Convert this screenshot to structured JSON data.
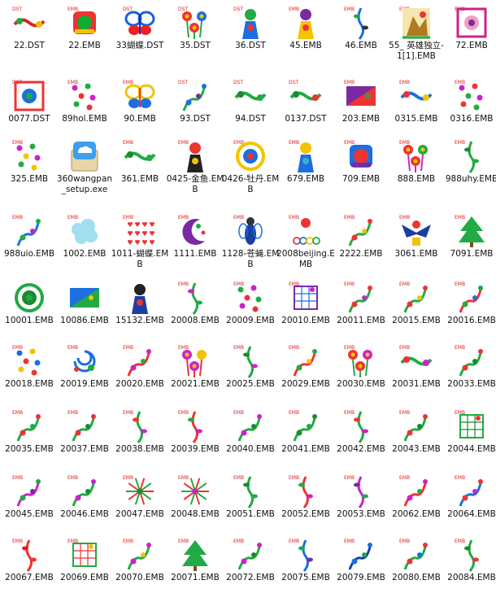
{
  "files": [
    {
      "name": "22.DST",
      "tag": "DST",
      "colors": [
        "#d22",
        "#2a4",
        "#e6c000"
      ],
      "motif": "wide"
    },
    {
      "name": "22.EMB",
      "tag": "EMB",
      "colors": [
        "#1a3",
        "#e33",
        "#f2c400"
      ],
      "motif": "badge"
    },
    {
      "name": "33蝴蝶.DST",
      "tag": "DST",
      "colors": [
        "#1c5fe0",
        "#e22",
        "#22b"
      ],
      "motif": "butterfly"
    },
    {
      "name": "35.DST",
      "tag": "DST",
      "colors": [
        "#e33",
        "#2a4",
        "#1b6fe0"
      ],
      "motif": "flowers"
    },
    {
      "name": "36.DST",
      "tag": "DST",
      "colors": [
        "#2a4",
        "#1b6fe0",
        "#e33"
      ],
      "motif": "figure"
    },
    {
      "name": "45.EMB",
      "tag": "EMB",
      "colors": [
        "#7a2aa0",
        "#f2c400",
        "#e33"
      ],
      "motif": "figure"
    },
    {
      "name": "46.EMB",
      "tag": "EMB",
      "colors": [
        "#1b6fe0",
        "#2a4",
        "#333"
      ],
      "motif": "stem"
    },
    {
      "name": "55_ 英雄独立-1[1].EMB",
      "tag": "EMB",
      "colors": [
        "#2a4",
        "#b07a20",
        "#e33"
      ],
      "motif": "scene"
    },
    {
      "name": "72.EMB",
      "tag": "EMB",
      "colors": [
        "#c28",
        "#f0a0c0",
        "#7a2aa0"
      ],
      "motif": "frame"
    },
    {
      "name": "0077.DST",
      "tag": "DST",
      "colors": [
        "#e33",
        "#1b6fe0",
        "#2a4"
      ],
      "motif": "frame"
    },
    {
      "name": "89hol.EMB",
      "tag": "EMB",
      "colors": [
        "#c2c",
        "#2a4",
        "#e33"
      ],
      "motif": "dots"
    },
    {
      "name": "90.EMB",
      "tag": "EMB",
      "colors": [
        "#f2c400",
        "#1b6fe0",
        "#e33"
      ],
      "motif": "butterfly"
    },
    {
      "name": "93.DST",
      "tag": "DST",
      "colors": [
        "#2a4",
        "#1b6fe0",
        "#7a2aa0"
      ],
      "motif": "vine"
    },
    {
      "name": "94.DST",
      "tag": "DST",
      "colors": [
        "#2a4",
        "#1a8a30",
        "#2a4"
      ],
      "motif": "wide"
    },
    {
      "name": "0137.DST",
      "tag": "DST",
      "colors": [
        "#2a4",
        "#1a8a30",
        "#e33"
      ],
      "motif": "wide"
    },
    {
      "name": "203.EMB",
      "tag": "EMB",
      "colors": [
        "#7a2aa0",
        "#e33",
        "#2a4"
      ],
      "motif": "flag"
    },
    {
      "name": "0315.EMB",
      "tag": "EMB",
      "colors": [
        "#1b6fe0",
        "#e33",
        "#f2c400"
      ],
      "motif": "wide"
    },
    {
      "name": "0316.EMB",
      "tag": "EMB",
      "colors": [
        "#c2c",
        "#e33",
        "#2a4"
      ],
      "motif": "dots"
    },
    {
      "name": "325.EMB",
      "tag": "EMB",
      "colors": [
        "#c2c",
        "#2a4",
        "#f2c400"
      ],
      "motif": "dots"
    },
    {
      "name": "360wangpan_setup.exe",
      "tag": "",
      "colors": [
        "#3aa0f0",
        "#1b6fe0",
        "#ffffff"
      ],
      "motif": "exe"
    },
    {
      "name": "361.EMB",
      "tag": "EMB",
      "colors": [
        "#2a4",
        "#1a8a30",
        "#2a4"
      ],
      "motif": "wide"
    },
    {
      "name": "0425-金鱼.EMB",
      "tag": "EMB",
      "colors": [
        "#e33",
        "#222",
        "#f2c400"
      ],
      "motif": "figure"
    },
    {
      "name": "0426-牡丹.EMB",
      "tag": "EMB",
      "colors": [
        "#f2c400",
        "#1b6fe0",
        "#e33"
      ],
      "motif": "round"
    },
    {
      "name": "679.EMB",
      "tag": "EMB",
      "colors": [
        "#f2c400",
        "#1b6fe0",
        "#3ab0d0"
      ],
      "motif": "figure"
    },
    {
      "name": "709.EMB",
      "tag": "EMB",
      "colors": [
        "#e33",
        "#1b6fe0",
        "#7a2aa0"
      ],
      "motif": "badge"
    },
    {
      "name": "888.EMB",
      "tag": "EMB",
      "colors": [
        "#e33",
        "#c2c",
        "#2a4"
      ],
      "motif": "flowers"
    },
    {
      "name": "988uhy.EMB",
      "tag": "EMB",
      "colors": [
        "#2a4",
        "#1a8a30",
        "#2a4"
      ],
      "motif": "stem"
    },
    {
      "name": "988uio.EMB",
      "tag": "EMB",
      "colors": [
        "#1b6fe0",
        "#2a4",
        "#c2c"
      ],
      "motif": "vine"
    },
    {
      "name": "1002.EMB",
      "tag": "EMB",
      "colors": [
        "#a0dff0",
        "#c0eefa",
        "#a0dff0"
      ],
      "motif": "cloud"
    },
    {
      "name": "1011-蝴蝶.EMB",
      "tag": "EMB",
      "colors": [
        "#e33",
        "#d22",
        "#e33"
      ],
      "motif": "hearts"
    },
    {
      "name": "1111.EMB",
      "tag": "EMB",
      "colors": [
        "#7a2aa0",
        "#2a4",
        "#e33"
      ],
      "motif": "moon"
    },
    {
      "name": "1128-苍蝇.EMB",
      "tag": "EMB",
      "colors": [
        "#1b3fa0",
        "#333",
        "#1b6fe0"
      ],
      "motif": "insect"
    },
    {
      "name": "2008beijing.EMB",
      "tag": "EMB",
      "colors": [
        "#e33",
        "#1b6fe0",
        "#f2c400"
      ],
      "motif": "rings"
    },
    {
      "name": "2222.EMB",
      "tag": "EMB",
      "colors": [
        "#2a4",
        "#e33",
        "#f2c400"
      ],
      "motif": "vine"
    },
    {
      "name": "3061.EMB",
      "tag": "EMB",
      "colors": [
        "#1b3fa0",
        "#e33",
        "#f2c400"
      ],
      "motif": "eagle"
    },
    {
      "name": "7091.EMB",
      "tag": "EMB",
      "colors": [
        "#2a4",
        "#1a8a30",
        "#2a4"
      ],
      "motif": "tree"
    },
    {
      "name": "10001.EMB",
      "tag": "",
      "colors": [
        "#2a4",
        "#1a8a30",
        "#2a4"
      ],
      "motif": "round"
    },
    {
      "name": "10086.EMB",
      "tag": "",
      "colors": [
        "#1b6fe0",
        "#2a4",
        "#f2c400"
      ],
      "motif": "flag"
    },
    {
      "name": "15132.EMB",
      "tag": "",
      "colors": [
        "#222",
        "#1b3fa0",
        "#e33"
      ],
      "motif": "figure"
    },
    {
      "name": "20008.EMB",
      "tag": "EMB",
      "colors": [
        "#2a4",
        "#c2c",
        "#2a4"
      ],
      "motif": "stem"
    },
    {
      "name": "20009.EMB",
      "tag": "EMB",
      "colors": [
        "#2a4",
        "#c2c",
        "#e33"
      ],
      "motif": "dots"
    },
    {
      "name": "20010.EMB",
      "tag": "EMB",
      "colors": [
        "#7a2aa0",
        "#1b6fe0",
        "#c2c"
      ],
      "motif": "net"
    },
    {
      "name": "20011.EMB",
      "tag": "EMB",
      "colors": [
        "#2a4",
        "#e33",
        "#c2c"
      ],
      "motif": "vine"
    },
    {
      "name": "20015.EMB",
      "tag": "EMB",
      "colors": [
        "#2a4",
        "#e33",
        "#f2c400"
      ],
      "motif": "vine"
    },
    {
      "name": "20016.EMB",
      "tag": "EMB",
      "colors": [
        "#e33",
        "#2a4",
        "#1b6fe0"
      ],
      "motif": "vine"
    },
    {
      "name": "20018.EMB",
      "tag": "EMB",
      "colors": [
        "#1b6fe0",
        "#f2c400",
        "#e33"
      ],
      "motif": "dots"
    },
    {
      "name": "20019.EMB",
      "tag": "EMB",
      "colors": [
        "#1b6fe0",
        "#2a4",
        "#e33"
      ],
      "motif": "swirl"
    },
    {
      "name": "20020.EMB",
      "tag": "EMB",
      "colors": [
        "#e33",
        "#c2c",
        "#2a4"
      ],
      "motif": "vine"
    },
    {
      "name": "20021.EMB",
      "tag": "EMB",
      "colors": [
        "#c2c",
        "#e33",
        "#f2c400"
      ],
      "motif": "flowers"
    },
    {
      "name": "20025.EMB",
      "tag": "EMB",
      "colors": [
        "#2a4",
        "#1a8a30",
        "#c2c"
      ],
      "motif": "stem"
    },
    {
      "name": "20029.EMB",
      "tag": "EMB",
      "colors": [
        "#e33",
        "#2a4",
        "#f2c400"
      ],
      "motif": "vine"
    },
    {
      "name": "20030.EMB",
      "tag": "EMB",
      "colors": [
        "#e33",
        "#2a4",
        "#c2c"
      ],
      "motif": "flowers"
    },
    {
      "name": "20031.EMB",
      "tag": "EMB",
      "colors": [
        "#2a4",
        "#e33",
        "#c2c"
      ],
      "motif": "wide"
    },
    {
      "name": "20033.EMB",
      "tag": "EMB",
      "colors": [
        "#2a4",
        "#e33",
        "#1a8a30"
      ],
      "motif": "vine"
    },
    {
      "name": "20035.EMB",
      "tag": "EMB",
      "colors": [
        "#2a4",
        "#e33",
        "#2a4"
      ],
      "motif": "vine"
    },
    {
      "name": "20037.EMB",
      "tag": "EMB",
      "colors": [
        "#2a4",
        "#e33",
        "#1a8a30"
      ],
      "motif": "vine"
    },
    {
      "name": "20038.EMB",
      "tag": "EMB",
      "colors": [
        "#2a4",
        "#e33",
        "#c2c"
      ],
      "motif": "stem"
    },
    {
      "name": "20039.EMB",
      "tag": "EMB",
      "colors": [
        "#e33",
        "#2a4",
        "#c2c"
      ],
      "motif": "stem"
    },
    {
      "name": "20040.EMB",
      "tag": "EMB",
      "colors": [
        "#2a4",
        "#c2c",
        "#1a8a30"
      ],
      "motif": "vine"
    },
    {
      "name": "20041.EMB",
      "tag": "EMB",
      "colors": [
        "#2a4",
        "#1a8a30",
        "#2a4"
      ],
      "motif": "vine"
    },
    {
      "name": "20042.EMB",
      "tag": "EMB",
      "colors": [
        "#2a4",
        "#e33",
        "#c2c"
      ],
      "motif": "stem"
    },
    {
      "name": "20043.EMB",
      "tag": "EMB",
      "colors": [
        "#2a4",
        "#e33",
        "#1a8a30"
      ],
      "motif": "vine"
    },
    {
      "name": "20044.EMB",
      "tag": "EMB",
      "colors": [
        "#2a4",
        "#1a8a30",
        "#e33"
      ],
      "motif": "net"
    },
    {
      "name": "20045.EMB",
      "tag": "EMB",
      "colors": [
        "#c2c",
        "#2a4",
        "#7a2aa0"
      ],
      "motif": "vine"
    },
    {
      "name": "20046.EMB",
      "tag": "EMB",
      "colors": [
        "#2a4",
        "#c2c",
        "#1a8a30"
      ],
      "motif": "vine"
    },
    {
      "name": "20047.EMB",
      "tag": "EMB",
      "colors": [
        "#2a4",
        "#e33",
        "#1a8a30"
      ],
      "motif": "burst"
    },
    {
      "name": "20048.EMB",
      "tag": "EMB",
      "colors": [
        "#2a4",
        "#e33",
        "#c2c"
      ],
      "motif": "burst"
    },
    {
      "name": "20051.EMB",
      "tag": "EMB",
      "colors": [
        "#2a4",
        "#1a8a30",
        "#2a4"
      ],
      "motif": "stem"
    },
    {
      "name": "20052.EMB",
      "tag": "EMB",
      "colors": [
        "#e33",
        "#2a4",
        "#c2c"
      ],
      "motif": "stem"
    },
    {
      "name": "20053.EMB",
      "tag": "EMB",
      "colors": [
        "#c2c",
        "#7a2aa0",
        "#2a4"
      ],
      "motif": "stem"
    },
    {
      "name": "20062.EMB",
      "tag": "EMB",
      "colors": [
        "#e33",
        "#c2c",
        "#2a4"
      ],
      "motif": "vine"
    },
    {
      "name": "20064.EMB",
      "tag": "EMB",
      "colors": [
        "#1b6fe0",
        "#e33",
        "#c2c"
      ],
      "motif": "vine"
    },
    {
      "name": "20067.EMB",
      "tag": "EMB",
      "colors": [
        "#e33",
        "#d22",
        "#e33"
      ],
      "motif": "stem"
    },
    {
      "name": "20069.EMB",
      "tag": "EMB",
      "colors": [
        "#2a4",
        "#e33",
        "#f2c400"
      ],
      "motif": "net"
    },
    {
      "name": "20070.EMB",
      "tag": "EMB",
      "colors": [
        "#2a4",
        "#c2c",
        "#f2c400"
      ],
      "motif": "vine"
    },
    {
      "name": "20071.EMB",
      "tag": "EMB",
      "colors": [
        "#2a4",
        "#1a8a30",
        "#2a4"
      ],
      "motif": "tree"
    },
    {
      "name": "20072.EMB",
      "tag": "EMB",
      "colors": [
        "#2a4",
        "#c2c",
        "#1a8a30"
      ],
      "motif": "vine"
    },
    {
      "name": "20075.EMB",
      "tag": "EMB",
      "colors": [
        "#1b6fe0",
        "#2a4",
        "#7a2aa0"
      ],
      "motif": "stem"
    },
    {
      "name": "20079.EMB",
      "tag": "EMB",
      "colors": [
        "#1b3fa0",
        "#1b6fe0",
        "#2a4"
      ],
      "motif": "vine"
    },
    {
      "name": "20080.EMB",
      "tag": "EMB",
      "colors": [
        "#2a4",
        "#e33",
        "#1b6fe0"
      ],
      "motif": "vine"
    },
    {
      "name": "20084.EMB",
      "tag": "EMB",
      "colors": [
        "#2a4",
        "#1a8a30",
        "#e33"
      ],
      "motif": "stem"
    }
  ]
}
